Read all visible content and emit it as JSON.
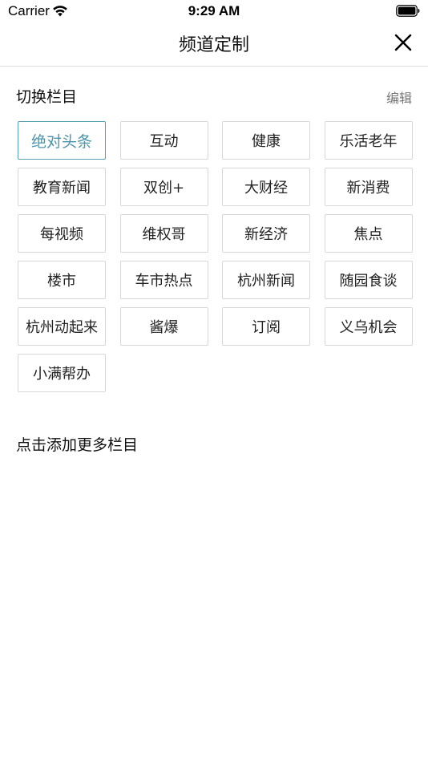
{
  "status_bar": {
    "carrier": "Carrier",
    "time": "9:29 AM",
    "wifi_icon": "wifi-icon",
    "battery_icon": "battery-icon"
  },
  "nav": {
    "title": "频道定制",
    "close_icon": "close-icon"
  },
  "section": {
    "title": "切换栏目",
    "edit_label": "编辑"
  },
  "channels": [
    {
      "label": "绝对头条",
      "active": true
    },
    {
      "label": "互动"
    },
    {
      "label": "健康"
    },
    {
      "label": "乐活老年"
    },
    {
      "label": "教育新闻"
    },
    {
      "label": "双创+"
    },
    {
      "label": "大财经"
    },
    {
      "label": "新消费"
    },
    {
      "label": "每视频"
    },
    {
      "label": "维权哥"
    },
    {
      "label": "新经济"
    },
    {
      "label": "焦点"
    },
    {
      "label": "楼市"
    },
    {
      "label": "车市热点"
    },
    {
      "label": "杭州新闻"
    },
    {
      "label": "随园食谈"
    },
    {
      "label": "杭州动起来"
    },
    {
      "label": "酱爆"
    },
    {
      "label": "订阅"
    },
    {
      "label": "义乌机会"
    },
    {
      "label": "小满帮办"
    }
  ],
  "more": {
    "title": "点击添加更多栏目"
  },
  "colors": {
    "accent": "#4a95ab",
    "border": "#d8d8d8",
    "muted": "#777777"
  }
}
